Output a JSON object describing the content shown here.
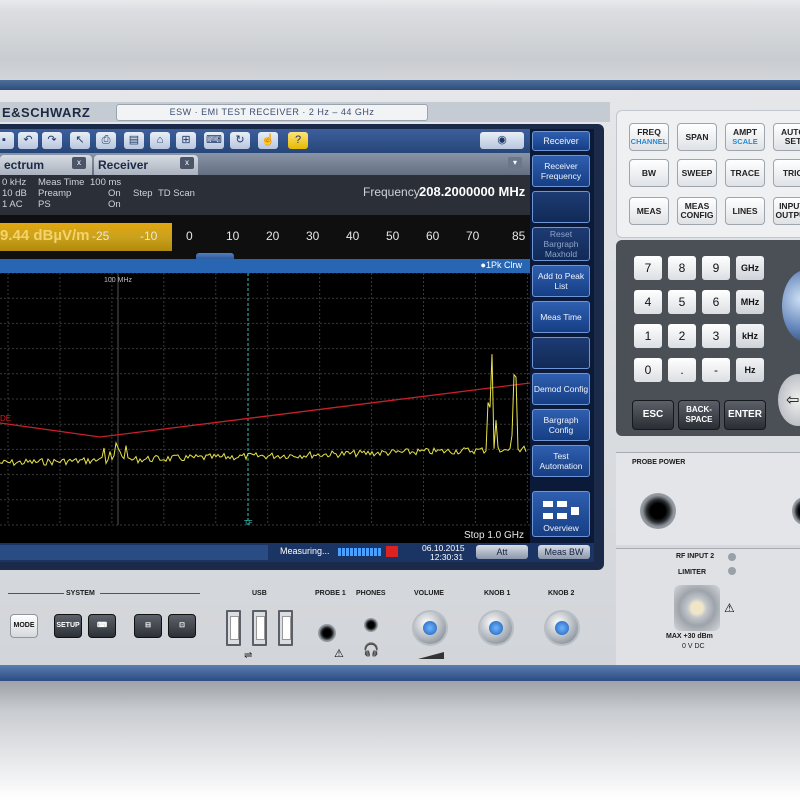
{
  "brand": "E&SCHWARZ",
  "model_line": "ESW · EMI TEST RECEIVER · 2 Hz – 44 GHz",
  "tabs": [
    {
      "label": "ectrum",
      "close": "x"
    },
    {
      "label": "Receiver",
      "close": "x"
    }
  ],
  "tab_menu": "▾",
  "info": {
    "col1": [
      "0 kHz",
      "10 dB",
      "1 AC"
    ],
    "meas_time_label": "Meas Time",
    "meas_time_value": "100 ms",
    "preamp_label": "Preamp",
    "preamp_value": "On",
    "ps_label": "PS",
    "ps_value": "On",
    "step_label": "Step",
    "step_value": "TD Scan",
    "frequency_label": "Frequency",
    "frequency_value": "208.2000000 MHz"
  },
  "bargraph": {
    "value": "9.44 dBµV/m",
    "scale": [
      "-25",
      "-10",
      "0",
      "10",
      "20",
      "30",
      "40",
      "50",
      "60",
      "70",
      "85"
    ],
    "fill_fraction": 0.54
  },
  "trace_label": "●1Pk Clrw",
  "plot": {
    "marker_label": "100 MHz",
    "marker_tf": "TF",
    "limit_label": "DE",
    "stop_label": "Stop 1.0 GHz"
  },
  "status": {
    "measuring": "Measuring...",
    "date": "06.10.2015",
    "time": "12:30:31",
    "att_label": "Att",
    "meas_bw_label": "Meas BW"
  },
  "softkeys": [
    {
      "label": "Receiver",
      "blank": false
    },
    {
      "label": "Receiver Frequency",
      "blank": false
    },
    {
      "label": "",
      "blank": true
    },
    {
      "label": "Reset Bargraph Maxhold",
      "blank": false
    },
    {
      "label": "Add to Peak List",
      "blank": false
    },
    {
      "label": "Meas Time",
      "blank": false
    },
    {
      "label": "",
      "blank": true
    },
    {
      "label": "Demod Config",
      "blank": false
    },
    {
      "label": "Bargraph Config",
      "blank": false
    },
    {
      "label": "Test Automation",
      "blank": false
    },
    {
      "label": "Overview",
      "blank": false
    }
  ],
  "hardkeys": [
    {
      "label": "FREQ",
      "sub": "CHANNEL"
    },
    {
      "label": "SPAN",
      "sub": ""
    },
    {
      "label": "AMPT",
      "sub": "SCALE"
    },
    {
      "label": "AUTO SET",
      "sub": ""
    },
    {
      "label": "BW",
      "sub": ""
    },
    {
      "label": "SWEEP",
      "sub": ""
    },
    {
      "label": "TRACE",
      "sub": ""
    },
    {
      "label": "TRIG",
      "sub": ""
    },
    {
      "label": "MEAS",
      "sub": ""
    },
    {
      "label": "MEAS CONFIG",
      "sub": ""
    },
    {
      "label": "LINES",
      "sub": ""
    },
    {
      "label": "INPUT/ OUTPUT",
      "sub": ""
    }
  ],
  "keypad": [
    "7",
    "8",
    "9",
    "4",
    "5",
    "6",
    "1",
    "2",
    "3",
    "0",
    ".",
    "-"
  ],
  "unit_keys": [
    "GHz",
    "MHz",
    "kHz",
    "Hz"
  ],
  "edit_keys": [
    {
      "label": "ESC"
    },
    {
      "label": "BACK- SPACE"
    },
    {
      "label": "ENTER"
    }
  ],
  "panel": {
    "probe_power": "PROBE POWER",
    "rf_input": "RF INPUT 2",
    "limiter": "LIMITER",
    "max_rating": "MAX +30 dBm",
    "dc_rating": "0 V DC"
  },
  "bottom": {
    "system": "SYSTEM",
    "usb": "USB",
    "probe1": "PROBE 1",
    "phones": "PHONES",
    "volume": "VOLUME",
    "knob1": "KNOB 1",
    "knob2": "KNOB 2",
    "mode": "MODE",
    "setup": "SETUP"
  }
}
